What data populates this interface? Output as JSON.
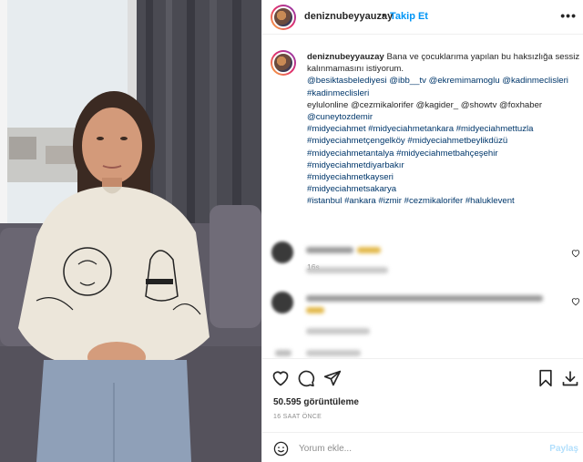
{
  "post": {
    "username": "deniznubeyyauzay",
    "follow_label": "Takip Et",
    "separator": "•",
    "more_label": "•••",
    "caption_lines": [
      {
        "text": "Bana ve çocuklarıma yapılan bu haksızlığa sessiz",
        "type": "text"
      },
      {
        "text": "kalınmamasını istiyorum.",
        "type": "text"
      },
      {
        "text": "@besiktasbelediyesi @ibb__tv @ekremimamoglu @kadinmeclisleri",
        "type": "tag"
      },
      {
        "text": "#kadinmeclisleri",
        "type": "tag"
      },
      {
        "text": "eylulonline @cezmikalorifer @kagider_ @showtv @foxhaber",
        "type": "mixed"
      },
      {
        "text": "@cuneytozdemir",
        "type": "tag"
      },
      {
        "text": "#midyeciahmet #midyeciahmetankara #midyeciahmettuzla",
        "type": "tag"
      },
      {
        "text": "#midyeciahmetçengelköy #midyeciahmetbeylikdüzü",
        "type": "tag"
      },
      {
        "text": "#midyeciahmetantalya #midyeciahmetbahçeşehir",
        "type": "tag"
      },
      {
        "text": "#midyeciahmetdiyarbakır",
        "type": "tag"
      },
      {
        "text": "#midyeciahmetkayseri",
        "type": "tag"
      },
      {
        "text": "#midyeciahmetsakarya",
        "type": "tag"
      },
      {
        "text": "#istanbul #ankara #izmir #cezmikalorifer #haluklevent",
        "type": "tag"
      }
    ],
    "caption_age": "16s",
    "views": "50.595 görüntüleme",
    "posted_ago": "16 SAAT ÖNCE",
    "comment_placeholder": "Yorum ekle...",
    "post_label": "Paylaş"
  },
  "colors": {
    "link": "#00376b",
    "follow": "#0095f6",
    "post_disabled": "#b2dffc",
    "muted": "#8e8e8e"
  },
  "icons": [
    "heart-icon",
    "comment-icon",
    "share-icon",
    "bookmark-icon",
    "download-icon",
    "emoji-icon"
  ]
}
